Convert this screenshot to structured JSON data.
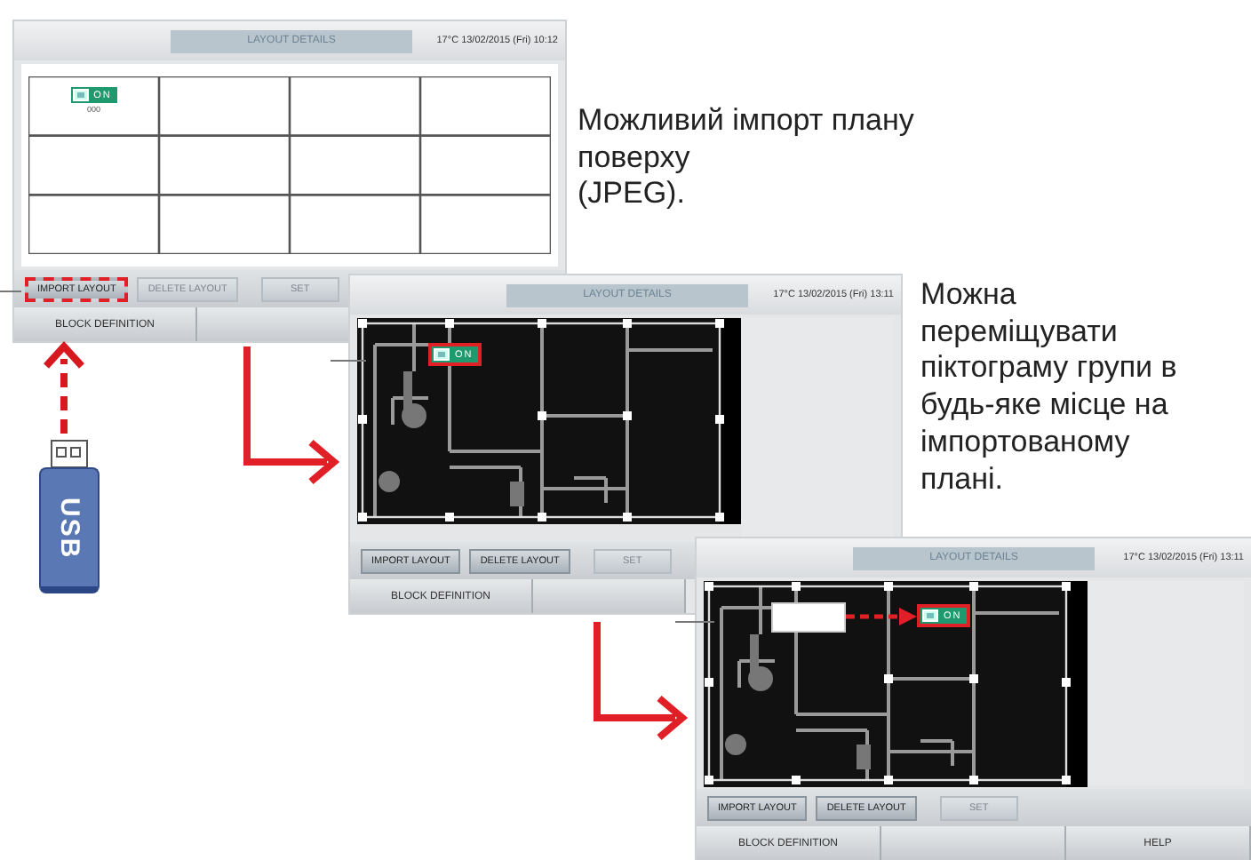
{
  "screens": [
    {
      "kind": "grid",
      "title": "LAYOUT DETAILS",
      "status": "17°C 13/02/2015 (Fri) 10:12",
      "icon": {
        "label": "ON",
        "caption": "000",
        "selected": false
      },
      "buttons": [
        {
          "label": "IMPORT LAYOUT",
          "disabled": false,
          "highlighted": true
        },
        {
          "label": "DELETE LAYOUT",
          "disabled": true,
          "highlighted": false
        },
        {
          "label": "SET",
          "disabled": true,
          "highlighted": false
        }
      ],
      "tabs": [
        "BLOCK DEFINITION"
      ]
    },
    {
      "kind": "floorplan",
      "title": "LAYOUT DETAILS",
      "status": "17°C 13/02/2015 (Fri) 13:11",
      "icon": {
        "label": "ON",
        "selected": true
      },
      "buttons": [
        {
          "label": "IMPORT LAYOUT",
          "disabled": false,
          "highlighted": false
        },
        {
          "label": "DELETE LAYOUT",
          "disabled": false,
          "highlighted": false
        },
        {
          "label": "SET",
          "disabled": true,
          "highlighted": false
        }
      ],
      "tabs": [
        "BLOCK DEFINITION"
      ]
    },
    {
      "kind": "floorplan",
      "title": "LAYOUT DETAILS",
      "status": "17°C 13/02/2015 (Fri) 13:11",
      "icon": {
        "label": "ON",
        "selected": true,
        "moved": true
      },
      "buttons": [
        {
          "label": "IMPORT LAYOUT",
          "disabled": false,
          "highlighted": false
        },
        {
          "label": "DELETE LAYOUT",
          "disabled": false,
          "highlighted": false
        },
        {
          "label": "SET",
          "disabled": true,
          "highlighted": false
        }
      ],
      "tabs": [
        "BLOCK DEFINITION",
        "HELP"
      ]
    }
  ],
  "notes": [
    "Можливий імпорт плану\nповерху\n(JPEG).",
    "Можна\nпереміщувати\nпіктограму групи в\nбудь-яке місце на\nімпортованому\nплані."
  ],
  "usb": {
    "label": "USB"
  }
}
